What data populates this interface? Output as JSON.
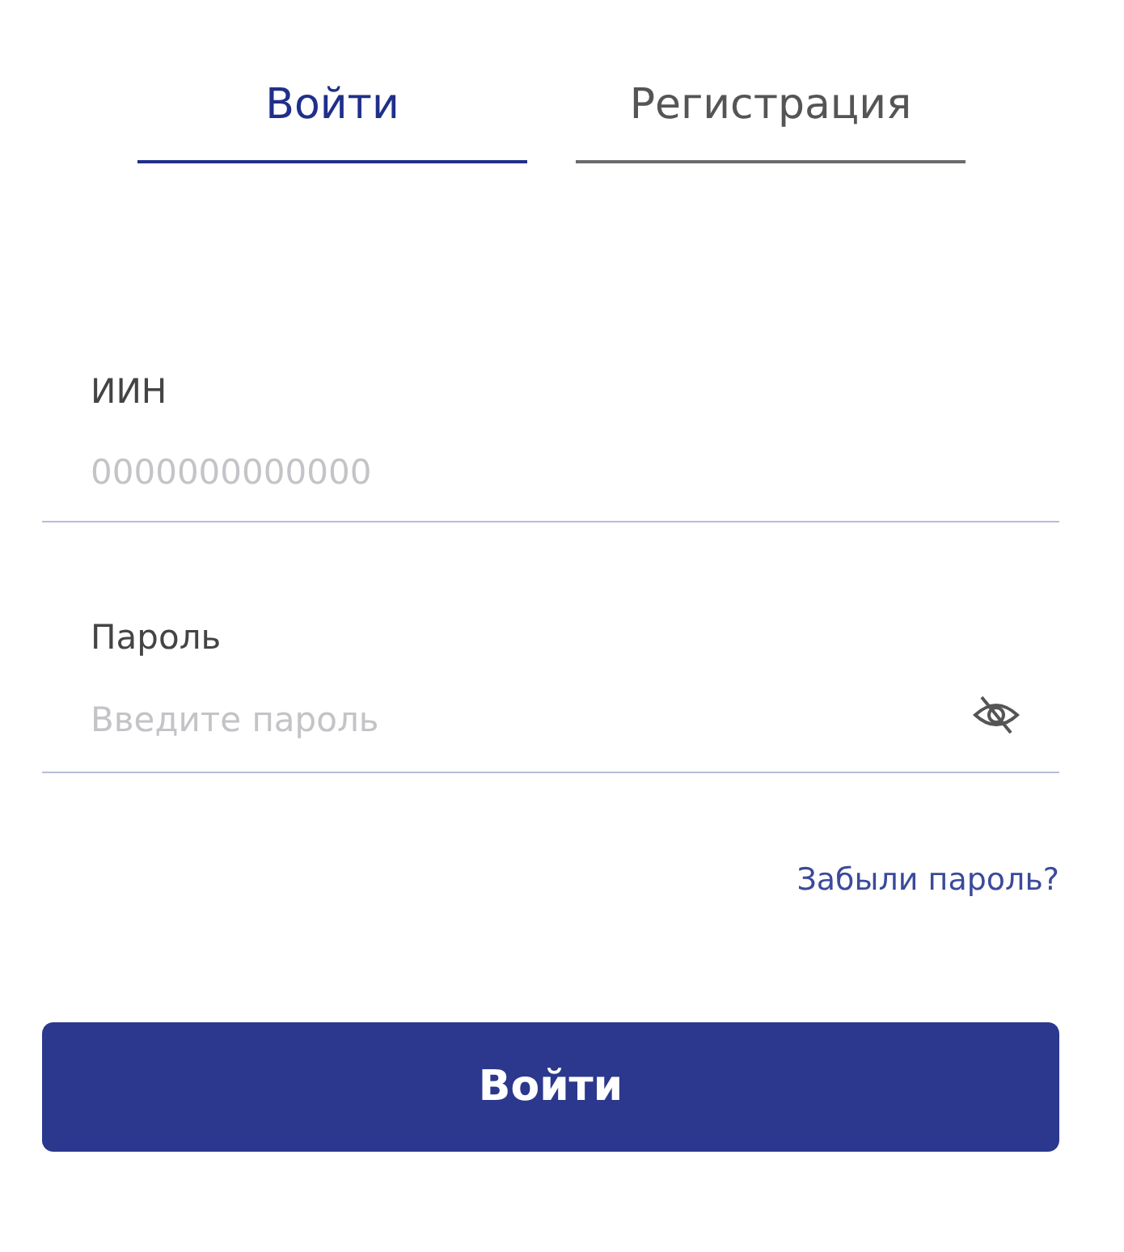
{
  "tabs": [
    {
      "label": "Войти",
      "selected": true
    },
    {
      "label": "Регистрация",
      "selected": false
    }
  ],
  "fields": [
    {
      "label": "ИИН",
      "placeholder": "0000000000000",
      "kind": "text"
    },
    {
      "label": "Пароль",
      "placeholder": "Введите пароль",
      "kind": "password",
      "visible": false
    }
  ],
  "forgot_link": "Забыли пароль?",
  "submit_button": "Войти"
}
